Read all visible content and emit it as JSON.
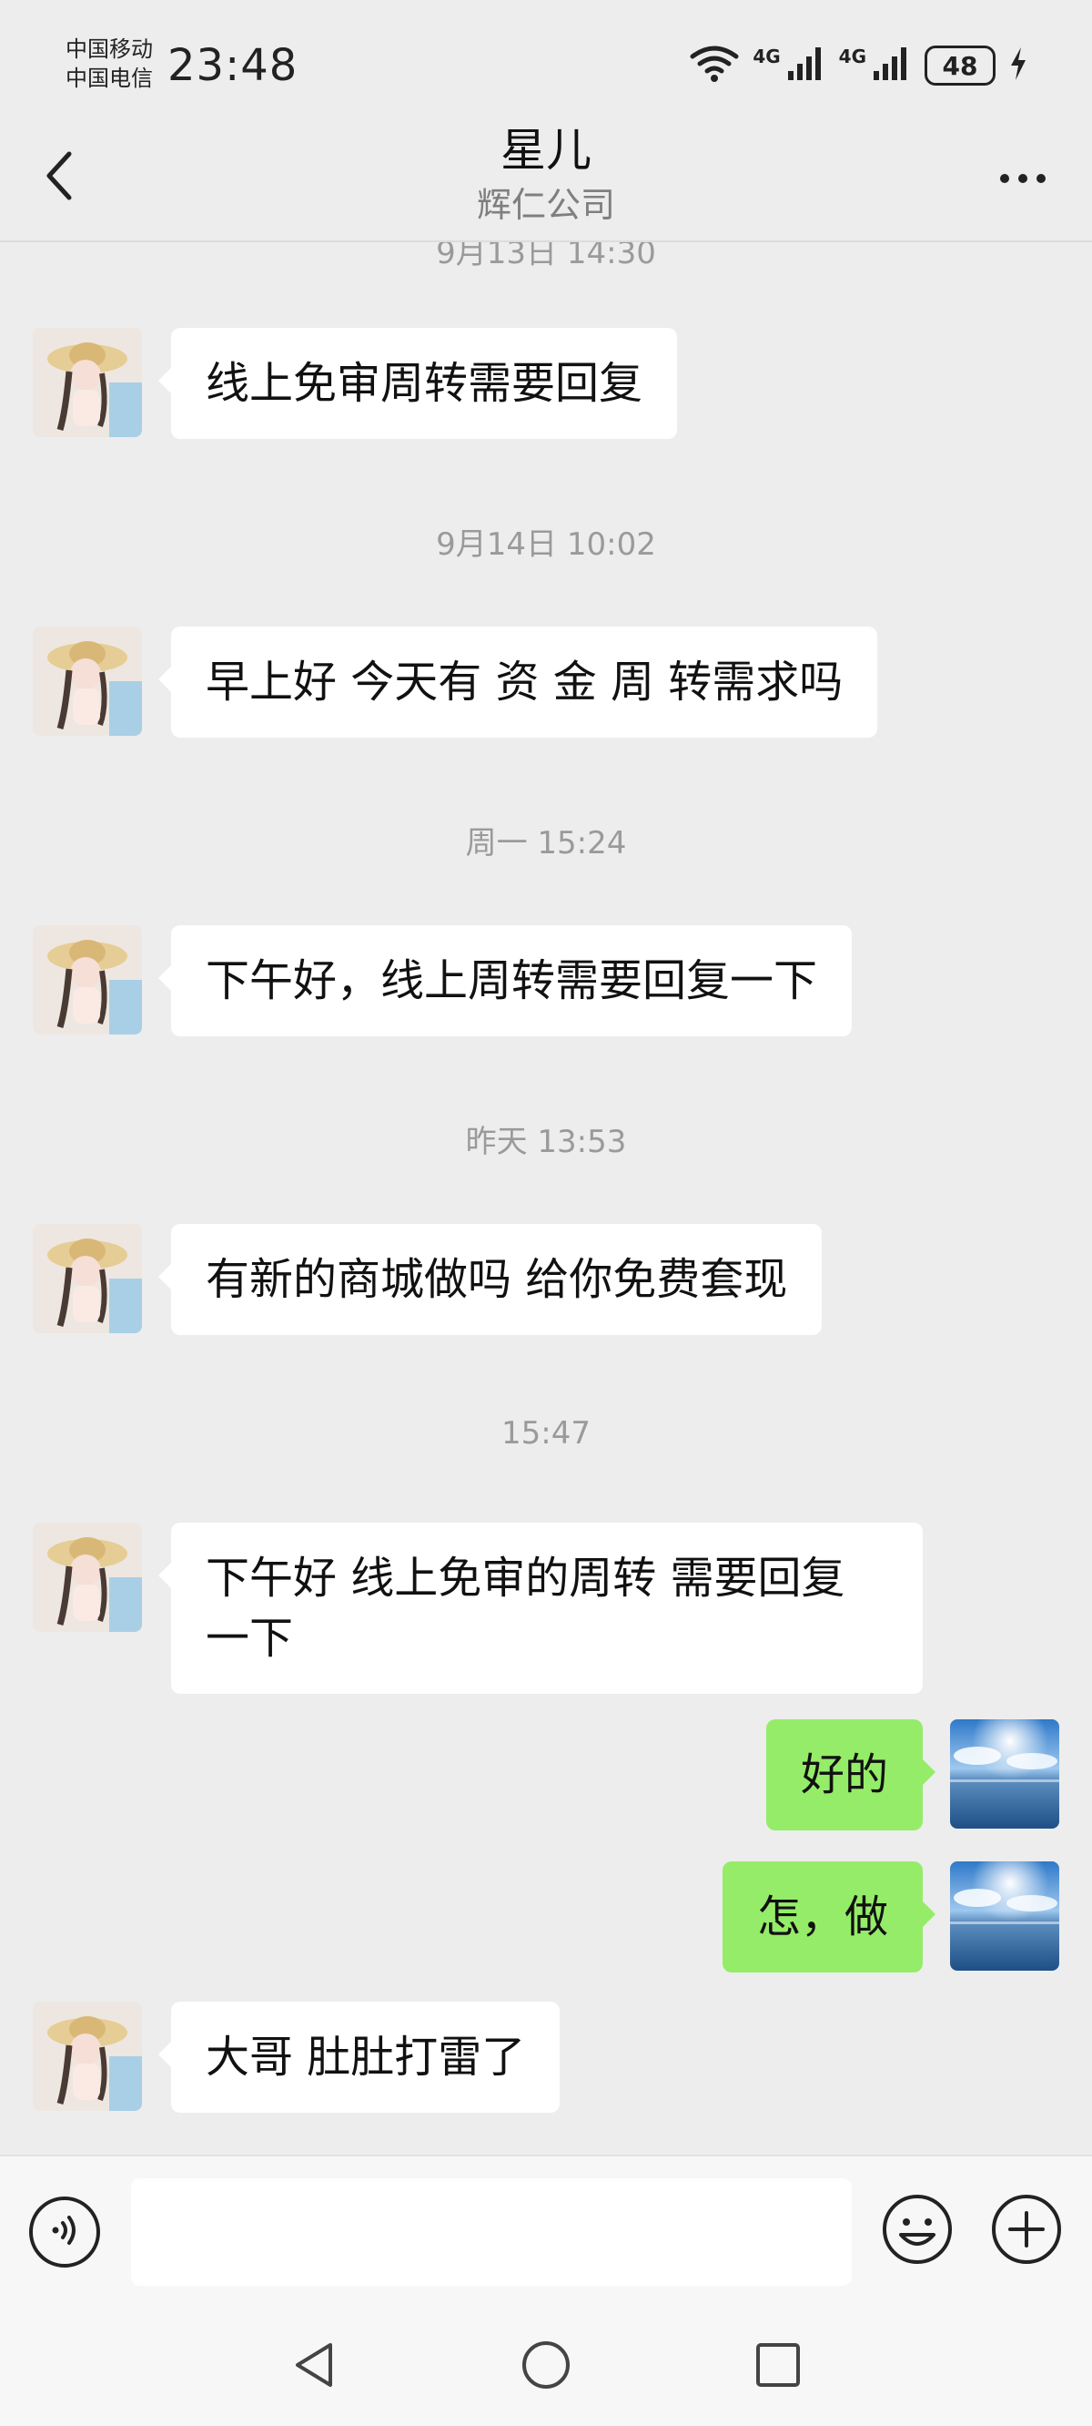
{
  "status_bar": {
    "carrier_1": "中国移动",
    "carrier_2": "中国电信",
    "time": "23:48",
    "network_1": "4G",
    "network_2": "4G",
    "battery": "48",
    "icons": [
      "wifi-icon",
      "signal-icon",
      "signal-icon",
      "battery-icon",
      "charging-icon"
    ]
  },
  "header": {
    "title": "星儿",
    "subtitle": "辉仁公司",
    "back_icon": "chevron-left-icon",
    "more_icon": "more-horizontal-icon"
  },
  "chat": {
    "partial_timestamp": "9月13日 14:30",
    "messages": [
      {
        "side": "in",
        "text": "线上免审周转需要回复"
      },
      {
        "type": "time",
        "text": "9月14日 10:02"
      },
      {
        "side": "in",
        "text": "早上好 今天有 资 金 周 转需求吗"
      },
      {
        "type": "time",
        "text": "周一 15:24"
      },
      {
        "side": "in",
        "text": "下午好，线上周转需要回复一下"
      },
      {
        "type": "time",
        "text": "昨天 13:53"
      },
      {
        "side": "in",
        "text": "有新的商城做吗 给你免费套现"
      },
      {
        "type": "time",
        "text": "15:47"
      },
      {
        "side": "in",
        "text": "下午好 线上免审的周转 需要回复一下"
      },
      {
        "side": "out",
        "text": "好的"
      },
      {
        "side": "out",
        "text": "怎，做"
      },
      {
        "side": "in",
        "text": "大哥 肚肚打雷了"
      }
    ],
    "contact_avatar": "girl-with-straw-hat-photo",
    "my_avatar": "ocean-sky-photo"
  },
  "input_bar": {
    "voice_icon": "voice-icon",
    "input_value": "",
    "emoji_icon": "emoji-icon",
    "plus_icon": "plus-circle-icon"
  },
  "nav_bar": {
    "back_icon": "nav-back-icon",
    "home_icon": "nav-home-icon",
    "recents_icon": "nav-recents-icon"
  },
  "colors": {
    "background": "#ededed",
    "incoming_bubble": "#ffffff",
    "outgoing_bubble": "#95ec69",
    "timestamp_text": "#9a9a9a"
  }
}
